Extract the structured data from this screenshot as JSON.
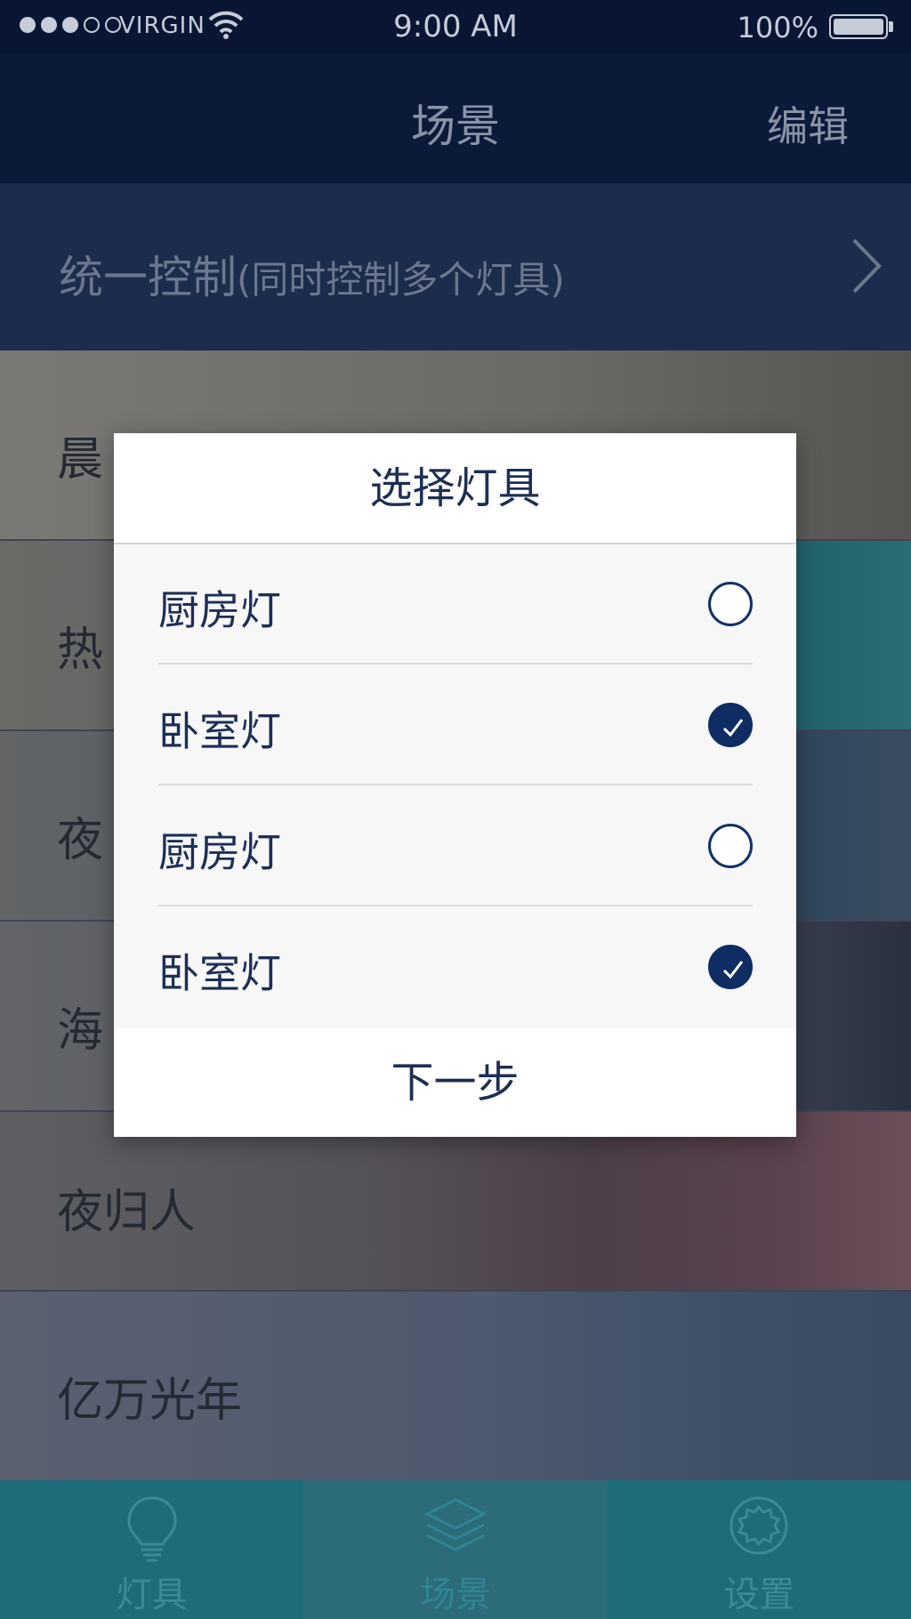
{
  "status": {
    "carrier": "VIRGIN",
    "time": "9:00 AM",
    "battery": "100%",
    "signal_strength": 3
  },
  "navbar": {
    "title": "场景",
    "edit_label": "编辑"
  },
  "unified": {
    "main": "统一控制",
    "sub": "(同时控制多个灯具)"
  },
  "scenes": [
    {
      "label": "晨",
      "color": "#6f6e6a"
    },
    {
      "label": "热",
      "color": "#2a5a63"
    },
    {
      "label": "夜",
      "color": "#1f3448"
    },
    {
      "label": "海",
      "color": "#2c3447"
    },
    {
      "label": "夜归人",
      "color": "#3a3038"
    },
    {
      "label": "亿万光年",
      "color": "#3b4a5e"
    }
  ],
  "dialog": {
    "title": "选择灯具",
    "options": [
      {
        "label": "厨房灯",
        "checked": false
      },
      {
        "label": "卧室灯",
        "checked": true
      },
      {
        "label": "厨房灯",
        "checked": false
      },
      {
        "label": "卧室灯",
        "checked": true
      }
    ],
    "next_label": "下一步"
  },
  "tabs": [
    {
      "label": "灯具",
      "icon": "bulb-icon",
      "active": false
    },
    {
      "label": "场景",
      "icon": "layers-icon",
      "active": true
    },
    {
      "label": "设置",
      "icon": "gear-icon",
      "active": false
    }
  ],
  "colors": {
    "accent": "#0f2d63",
    "tabbar": "#1e6c7a",
    "navbar": "#0c1a3a"
  }
}
